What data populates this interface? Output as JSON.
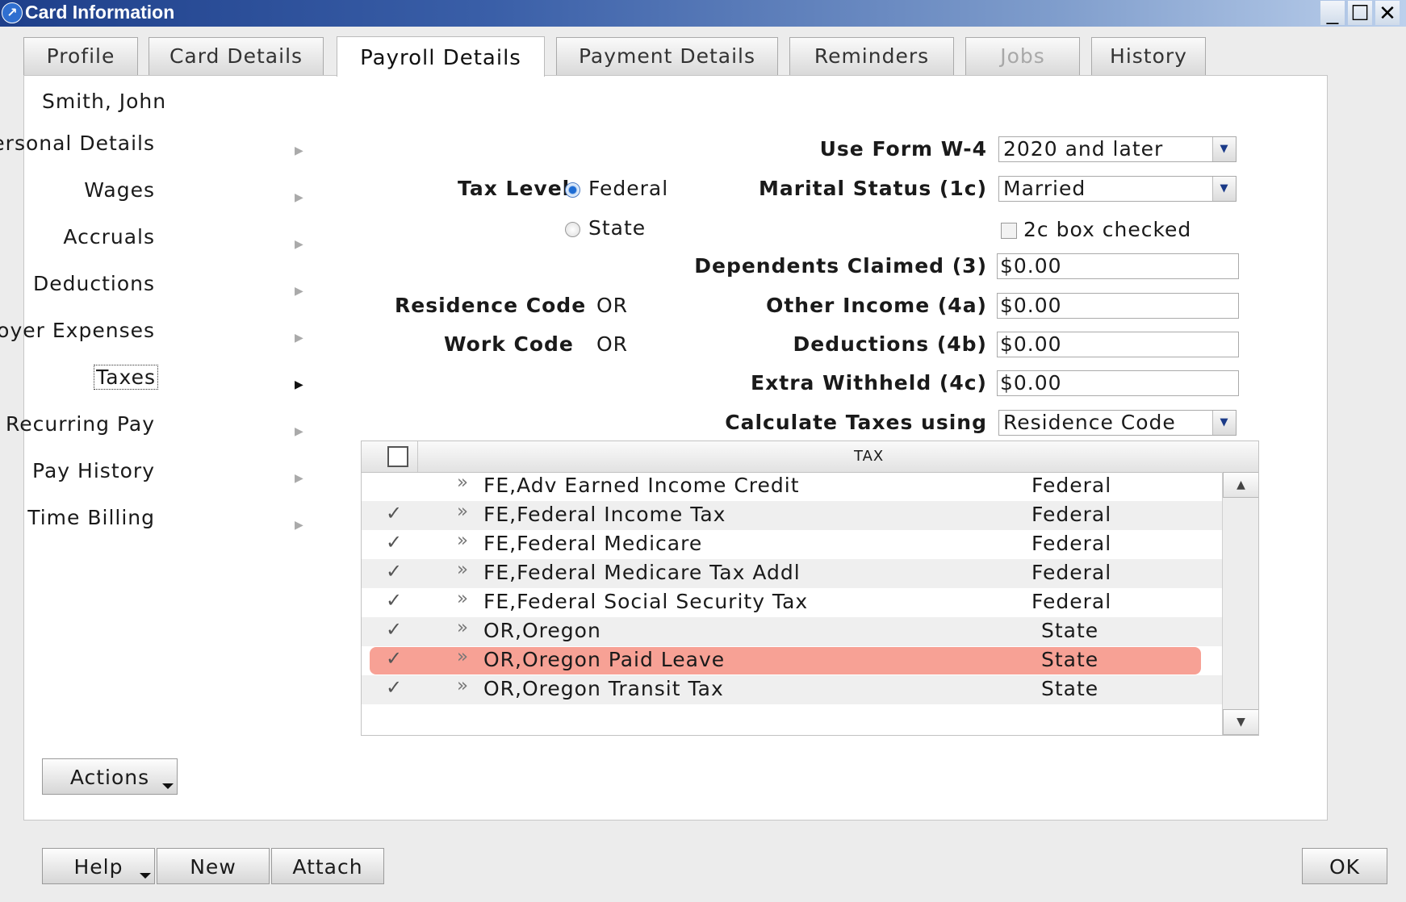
{
  "window": {
    "title": "Card Information",
    "controls": {
      "minimize": "_",
      "maximize": "☐",
      "close": "✕"
    }
  },
  "tabs": [
    {
      "label": "Profile",
      "state": "normal"
    },
    {
      "label": "Card Details",
      "state": "normal"
    },
    {
      "label": "Payroll Details",
      "state": "active"
    },
    {
      "label": "Payment Details",
      "state": "normal"
    },
    {
      "label": "Reminders",
      "state": "normal"
    },
    {
      "label": "Jobs",
      "state": "disabled"
    },
    {
      "label": "History",
      "state": "normal"
    }
  ],
  "card_name": "Smith, John",
  "side_nav": [
    {
      "label": "Personal Details"
    },
    {
      "label": "Wages"
    },
    {
      "label": "Accruals"
    },
    {
      "label": "Deductions"
    },
    {
      "label": "Employer Expenses"
    },
    {
      "label": "Taxes",
      "selected": true
    },
    {
      "label": "Recurring Pay"
    },
    {
      "label": "Pay History"
    },
    {
      "label": "Time Billing"
    }
  ],
  "tax_level": {
    "label": "Tax Level",
    "options": [
      {
        "label": "Federal",
        "selected": true
      },
      {
        "label": "State",
        "selected": false
      }
    ]
  },
  "codes": {
    "residence_label": "Residence Code",
    "residence_value": "OR",
    "work_label": "Work Code",
    "work_value": "OR"
  },
  "w4": {
    "use_form_label": "Use Form W-4",
    "use_form_value": "2020 and later",
    "marital_label": "Marital Status (1c)",
    "marital_value": "Married",
    "box2c_label": "2c box checked",
    "box2c_checked": false,
    "dependents_label": "Dependents Claimed (3)",
    "dependents_value": "$0.00",
    "other_income_label": "Other Income (4a)",
    "other_income_value": "$0.00",
    "deductions_label": "Deductions (4b)",
    "deductions_value": "$0.00",
    "extra_label": "Extra Withheld (4c)",
    "extra_value": "$0.00",
    "calc_label": "Calculate Taxes using",
    "calc_value": "Residence Code"
  },
  "tax_table": {
    "column_header": "TAX",
    "rows": [
      {
        "checked": false,
        "name": "FE,Adv Earned Income Credit",
        "level": "Federal"
      },
      {
        "checked": true,
        "name": "FE,Federal Income Tax",
        "level": "Federal"
      },
      {
        "checked": true,
        "name": "FE,Federal Medicare",
        "level": "Federal"
      },
      {
        "checked": true,
        "name": "FE,Federal Medicare Tax Addl",
        "level": "Federal"
      },
      {
        "checked": true,
        "name": "FE,Federal Social Security Tax",
        "level": "Federal"
      },
      {
        "checked": true,
        "name": "OR,Oregon",
        "level": "State"
      },
      {
        "checked": true,
        "name": "OR,Oregon Paid Leave",
        "level": "State",
        "highlighted": true
      },
      {
        "checked": true,
        "name": "OR,Oregon Transit Tax",
        "level": "State"
      }
    ],
    "highlight_color": "#f7a195"
  },
  "buttons": {
    "actions": "Actions",
    "help": "Help",
    "new": "New",
    "attach": "Attach",
    "ok": "OK"
  },
  "icons": {
    "app": "app-logo-icon",
    "check": "✓",
    "row_arrow": "»",
    "nav_arrow": "▶",
    "dropdown": "▼"
  },
  "colors": {
    "titlebar_start": "#1e3f8a",
    "titlebar_end": "#bcd0ec",
    "accent": "#1a3a88"
  }
}
